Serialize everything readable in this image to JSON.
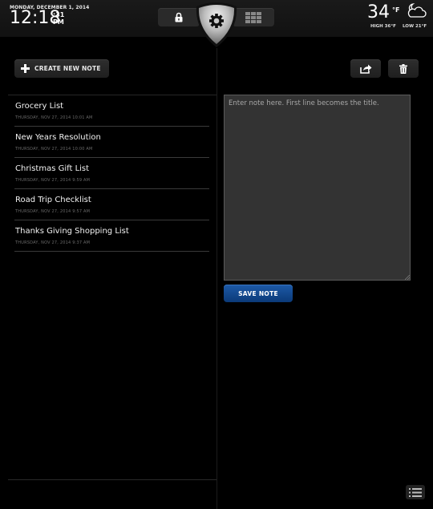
{
  "header": {
    "date": "MONDAY, DECEMBER 1, 2014",
    "time": "12:18",
    "seconds": ":31",
    "ampm": "PM",
    "nav": {
      "lock_icon": "lock-icon",
      "settings_icon": "gear-icon",
      "apps_icon": "grid-icon"
    },
    "weather": {
      "temperature": "34",
      "unit": "°F",
      "condition_icon": "partly-cloudy-night-icon",
      "high": "HIGH 36°F",
      "low": "LOW 21°F"
    }
  },
  "toolbar": {
    "create_label": "CREATE NEW NOTE",
    "create_icon": "plus-icon",
    "share_icon": "share-icon",
    "delete_icon": "trash-icon"
  },
  "notes": [
    {
      "title": "Grocery List",
      "date": "THURSDAY, NOV 27, 2014 10:01 AM"
    },
    {
      "title": "New Years Resolution",
      "date": "THURSDAY, NOV 27, 2014 10:00 AM"
    },
    {
      "title": "Christmas Gift List",
      "date": "THURSDAY, NOV 27, 2014 9:59 AM"
    },
    {
      "title": "Road Trip Checklist",
      "date": "THURSDAY, NOV 27, 2014 9:57 AM"
    },
    {
      "title": "Thanks Giving Shopping List",
      "date": "THURSDAY, NOV 27, 2014 9:37 AM"
    }
  ],
  "editor": {
    "value": "",
    "placeholder": "Enter note here. First line becomes the title.",
    "save_label": "SAVE NOTE"
  },
  "footer": {
    "list_view_icon": "list-icon"
  },
  "colors": {
    "accent": "#1d5aa8",
    "background": "#000000",
    "editor_bg": "#333333"
  }
}
